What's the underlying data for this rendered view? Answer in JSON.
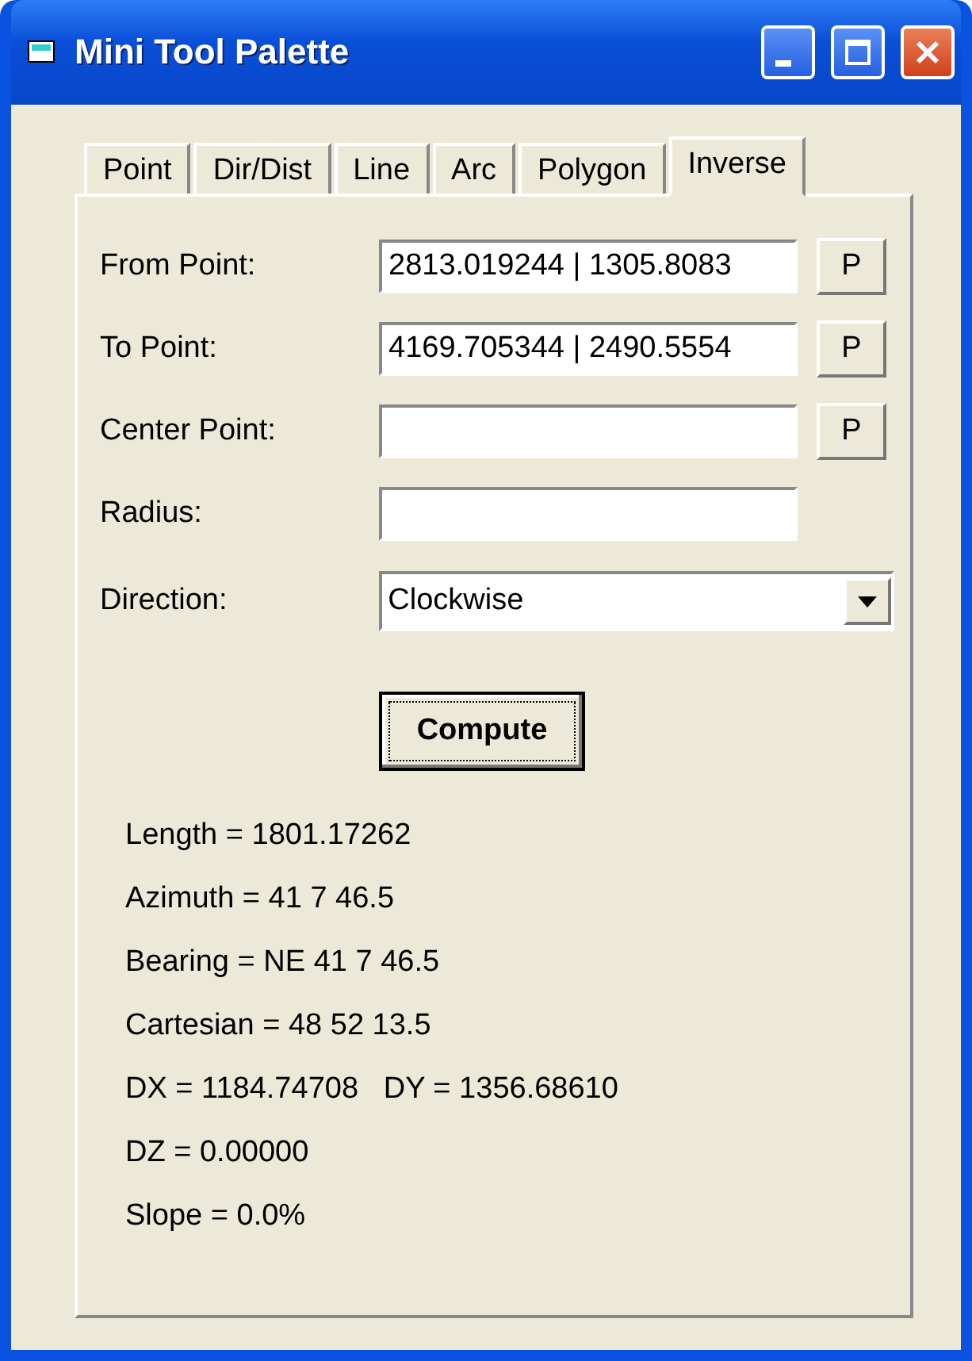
{
  "window": {
    "title": "Mini Tool Palette"
  },
  "tabs": [
    {
      "label": "Point",
      "selected": false
    },
    {
      "label": "Dir/Dist",
      "selected": false
    },
    {
      "label": "Line",
      "selected": false
    },
    {
      "label": "Arc",
      "selected": false
    },
    {
      "label": "Polygon",
      "selected": false
    },
    {
      "label": "Inverse",
      "selected": true
    }
  ],
  "fields": [
    {
      "kind": "point",
      "label": "From Point:",
      "value": "2813.019244 | 1305.8083",
      "button": "P"
    },
    {
      "kind": "point",
      "label": "To Point:",
      "value": "4169.705344 | 2490.5554",
      "button": "P"
    },
    {
      "kind": "point",
      "label": "Center Point:",
      "button": "P"
    },
    {
      "kind": "text",
      "label": "Radius:"
    },
    {
      "kind": "combo",
      "label": "Direction:",
      "value": "Clockwise"
    }
  ],
  "compute_button": "Compute",
  "results": [
    "Length = 1801.17262",
    "Azimuth = 41 7 46.5",
    "Bearing = NE 41 7 46.5",
    "Cartesian = 48 52 13.5",
    "DX = 1184.74708   DY = 1356.68610",
    "DZ = 0.00000",
    "Slope = 0.0%"
  ]
}
